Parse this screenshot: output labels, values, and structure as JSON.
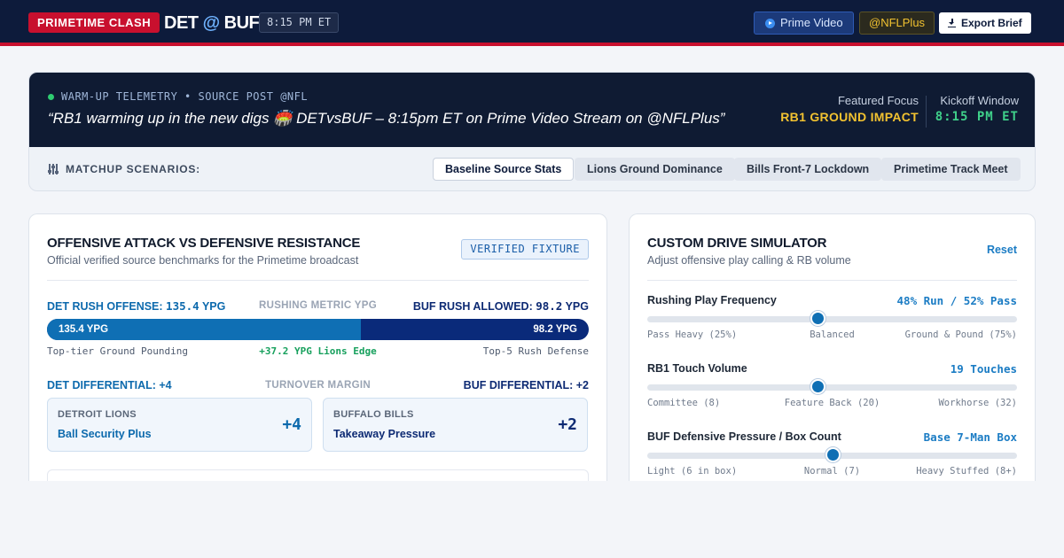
{
  "header": {
    "badge": "PRIMETIME CLASH",
    "away": "DET",
    "at": "@",
    "home": "BUF",
    "time": "8:15 PM ET",
    "prime_label": "Prime Video",
    "nflplus_label": "@NFLPlus",
    "export_label": "Export Brief"
  },
  "hero": {
    "telemetry": "WARM-UP TELEMETRY • SOURCE POST @NFL",
    "quote": "“RB1 warming up in the new digs 🏟️ DETvsBUF – 8:15pm ET on Prime Video Stream on @NFLPlus”",
    "focus_label": "Featured Focus",
    "focus_value": "RB1 GROUND IMPACT",
    "kickoff_label": "Kickoff Window",
    "kickoff_value": "8:15 PM ET"
  },
  "scenarios": {
    "label": "MATCHUP SCENARIOS:",
    "items": [
      {
        "label": "Baseline Source Stats",
        "active": true
      },
      {
        "label": "Lions Ground Dominance",
        "active": false
      },
      {
        "label": "Bills Front-7 Lockdown",
        "active": false
      },
      {
        "label": "Primetime Track Meet",
        "active": false
      }
    ]
  },
  "attack": {
    "title": "OFFENSIVE ATTACK VS DEFENSIVE RESISTANCE",
    "subtitle": "Official verified source benchmarks for the Primetime broadcast",
    "verified": "VERIFIED FIXTURE",
    "det_rush_label": "DET RUSH OFFENSE:",
    "det_rush_value": "135.4",
    "det_rush_unit": "YPG",
    "metric_label": "RUSHING METRIC YPG",
    "buf_rush_label": "BUF RUSH ALLOWED:",
    "buf_rush_value": "98.2",
    "buf_rush_unit": "YPG",
    "det_bar_label": "135.4 YPG",
    "buf_bar_label": "98.2 YPG",
    "det_share": 0.5796,
    "note_left": "Top-tier Ground Pounding",
    "note_mid": "+37.2 YPG Lions Edge",
    "note_right": "Top-5 Rush Defense",
    "det_diff": "DET DIFFERENTIAL: +4",
    "turnover_label": "TURNOVER MARGIN",
    "buf_diff": "BUF DIFFERENTIAL: +2",
    "det_team": "DETROIT LIONS",
    "det_metric": "Ball Security Plus",
    "det_val": "+4",
    "buf_team": "BUFFALO BILLS",
    "buf_metric": "Takeaway Pressure",
    "buf_val": "+2"
  },
  "simulator": {
    "title": "CUSTOM DRIVE SIMULATOR",
    "subtitle": "Adjust offensive play calling & RB volume",
    "reset": "Reset",
    "controls": [
      {
        "label": "Rushing Play Frequency",
        "value": "48% Run / 52% Pass",
        "level": 0.46,
        "min": "Pass Heavy (25%)",
        "mid": "Balanced",
        "max": "Ground & Pound (75%)"
      },
      {
        "label": "RB1 Touch Volume",
        "value": "19 Touches",
        "level": 0.46,
        "min": "Committee (8)",
        "mid": "Feature Back (20)",
        "max": "Workhorse (32)"
      },
      {
        "label": "BUF Defensive Pressure / Box Count",
        "value": "Base 7-Man Box",
        "level": 0.5,
        "min": "Light (6 in box)",
        "mid": "Normal (7)",
        "max": "Heavy Stuffed (8+)"
      }
    ]
  }
}
